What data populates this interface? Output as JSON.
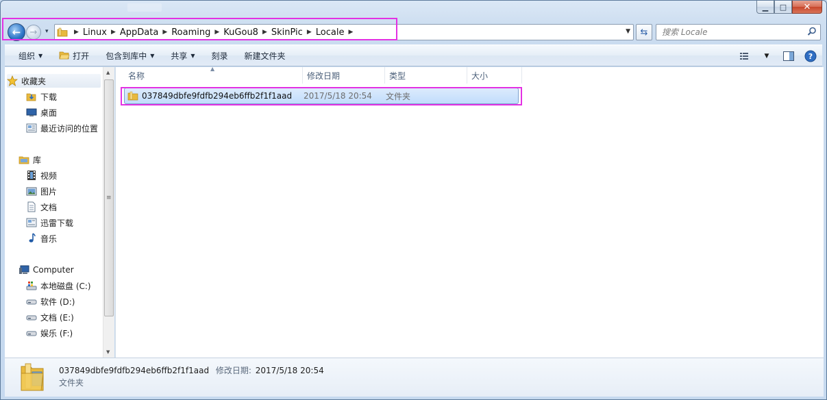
{
  "window": {
    "caption": {
      "minimize": "▁",
      "maximize": "□",
      "close": "✕"
    }
  },
  "nav": {
    "back_glyph": "←",
    "forward_glyph": "→",
    "recent_glyph": "▾",
    "refresh_glyph": "⇆"
  },
  "address": {
    "crumbs": [
      "Linux",
      "AppData",
      "Roaming",
      "KuGou8",
      "SkinPic",
      "Locale"
    ]
  },
  "search": {
    "placeholder": "搜索 Locale"
  },
  "toolbar": {
    "organize": "组织",
    "open": "打开",
    "include_in_library": "包含到库中",
    "share": "共享",
    "burn": "刻录",
    "new_folder": "新建文件夹"
  },
  "sidebar": {
    "favorites": {
      "title": "收藏夹",
      "items": [
        {
          "label": "下载",
          "icon": "download-folder-icon"
        },
        {
          "label": "桌面",
          "icon": "desktop-icon"
        },
        {
          "label": "最近访问的位置",
          "icon": "recent-places-icon"
        }
      ]
    },
    "libraries": {
      "title": "库",
      "items": [
        {
          "label": "视频",
          "icon": "video-library-icon"
        },
        {
          "label": "图片",
          "icon": "pictures-library-icon"
        },
        {
          "label": "文档",
          "icon": "documents-library-icon"
        },
        {
          "label": "迅雷下载",
          "icon": "thunder-download-icon"
        },
        {
          "label": "音乐",
          "icon": "music-library-icon"
        }
      ]
    },
    "computer": {
      "title": "Computer",
      "items": [
        {
          "label": "本地磁盘 (C:)",
          "icon": "system-drive-icon"
        },
        {
          "label": "软件 (D:)",
          "icon": "drive-icon"
        },
        {
          "label": "文档 (E:)",
          "icon": "drive-icon"
        },
        {
          "label": "娱乐 (F:)",
          "icon": "drive-icon"
        }
      ]
    }
  },
  "list": {
    "columns": {
      "name": "名称",
      "modified": "修改日期",
      "type": "类型",
      "size": "大小"
    },
    "rows": [
      {
        "name": "037849dbfe9fdfb294eb6ffb2f1f1aad",
        "modified": "2017/5/18 20:54",
        "type": "文件夹",
        "size": ""
      }
    ]
  },
  "details": {
    "name": "037849dbfe9fdfb294eb6ffb2f1f1aad",
    "modified_label": "修改日期:",
    "modified_value": "2017/5/18 20:54",
    "type": "文件夹"
  },
  "colors": {
    "highlight": "#e331e3",
    "selection": "#c1dcfc",
    "folder": "#e8b93e"
  }
}
